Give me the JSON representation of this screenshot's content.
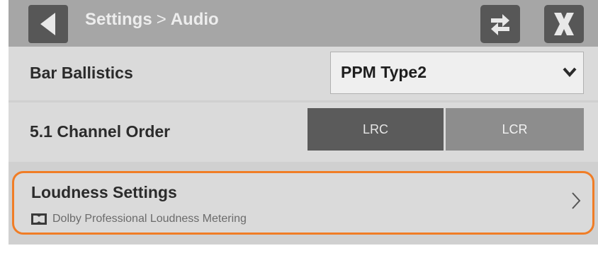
{
  "header": {
    "breadcrumb_parent": "Settings",
    "breadcrumb_separator": ">",
    "breadcrumb_current": "Audio",
    "back_icon": "back-triangle-icon",
    "swap_icon": "swap-arrows-icon",
    "close_icon": "close-x-icon"
  },
  "bar_ballistics": {
    "label": "Bar Ballistics",
    "selected_value": "PPM Type2"
  },
  "channel_order": {
    "label": "5.1 Channel Order",
    "options": [
      {
        "label": "LRC",
        "selected": true
      },
      {
        "label": "LCR",
        "selected": false
      }
    ]
  },
  "loudness": {
    "title": "Loudness Settings",
    "subtitle": "Dolby Professional Loudness Metering",
    "logo_icon": "dolby-logo-icon",
    "chevron_icon": "chevron-right-icon"
  },
  "colors": {
    "accent": "#f07d26",
    "header_bg": "#a6a6a6",
    "button_dark": "#575757",
    "segment_selected": "#5b5b5b",
    "segment_unselected": "#8d8d8d"
  }
}
